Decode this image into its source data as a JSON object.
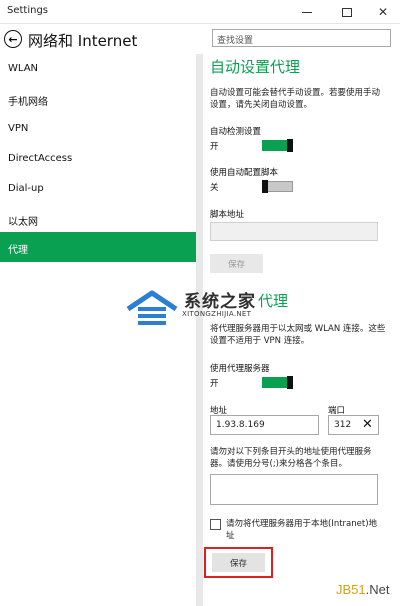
{
  "window": {
    "title": "Settings",
    "close_glyph": "✕"
  },
  "header": {
    "back_glyph": "←",
    "title": "网络和 Internet",
    "search_placeholder": "查找设置"
  },
  "sidebar": {
    "items": [
      {
        "label": "WLAN"
      },
      {
        "label": "手机网络"
      },
      {
        "label": "VPN"
      },
      {
        "label": "DirectAccess"
      },
      {
        "label": "Dial-up"
      },
      {
        "label": "以太网"
      },
      {
        "label": "代理"
      }
    ],
    "active_index": 6
  },
  "auto_proxy": {
    "title": "自动设置代理",
    "description": "自动设置可能会替代手动设置。若要使用手动设置，请先关闭自动设置。",
    "auto_detect": {
      "label": "自动检测设置",
      "state_text": "开",
      "on": true
    },
    "use_script": {
      "label": "使用自动配置脚本",
      "state_text": "关",
      "on": false
    },
    "script_address": {
      "label": "脚本地址",
      "value": ""
    },
    "save_label": "保存"
  },
  "manual_proxy": {
    "title_suffix": "代理",
    "description": "将代理服务器用于以太网或 WLAN 连接。这些设置不适用于 VPN 连接。",
    "use_proxy": {
      "label": "使用代理服务器",
      "state_text": "开",
      "on": true
    },
    "address": {
      "label": "地址",
      "value": "1.93.8.169"
    },
    "port": {
      "label": "端口",
      "value": "312",
      "clear_glyph": "✕"
    },
    "exceptions": {
      "label": "请勿对以下列条目开头的地址使用代理服务器。请使用分号(;)来分格各个条目。",
      "value": ""
    },
    "bypass_local": {
      "label": "请勿将代理服务器用于本地(Intranet)地址",
      "checked": false
    },
    "save_label": "保存"
  },
  "watermark": {
    "brand": "系统之家",
    "url": "XITONGZHIJIA.NET",
    "site_logo_main": "JB51",
    "site_logo_suffix": ".Net"
  },
  "colors": {
    "accent": "#0aa051",
    "highlight_border": "#e02020",
    "toggle_knob": "#111111"
  }
}
